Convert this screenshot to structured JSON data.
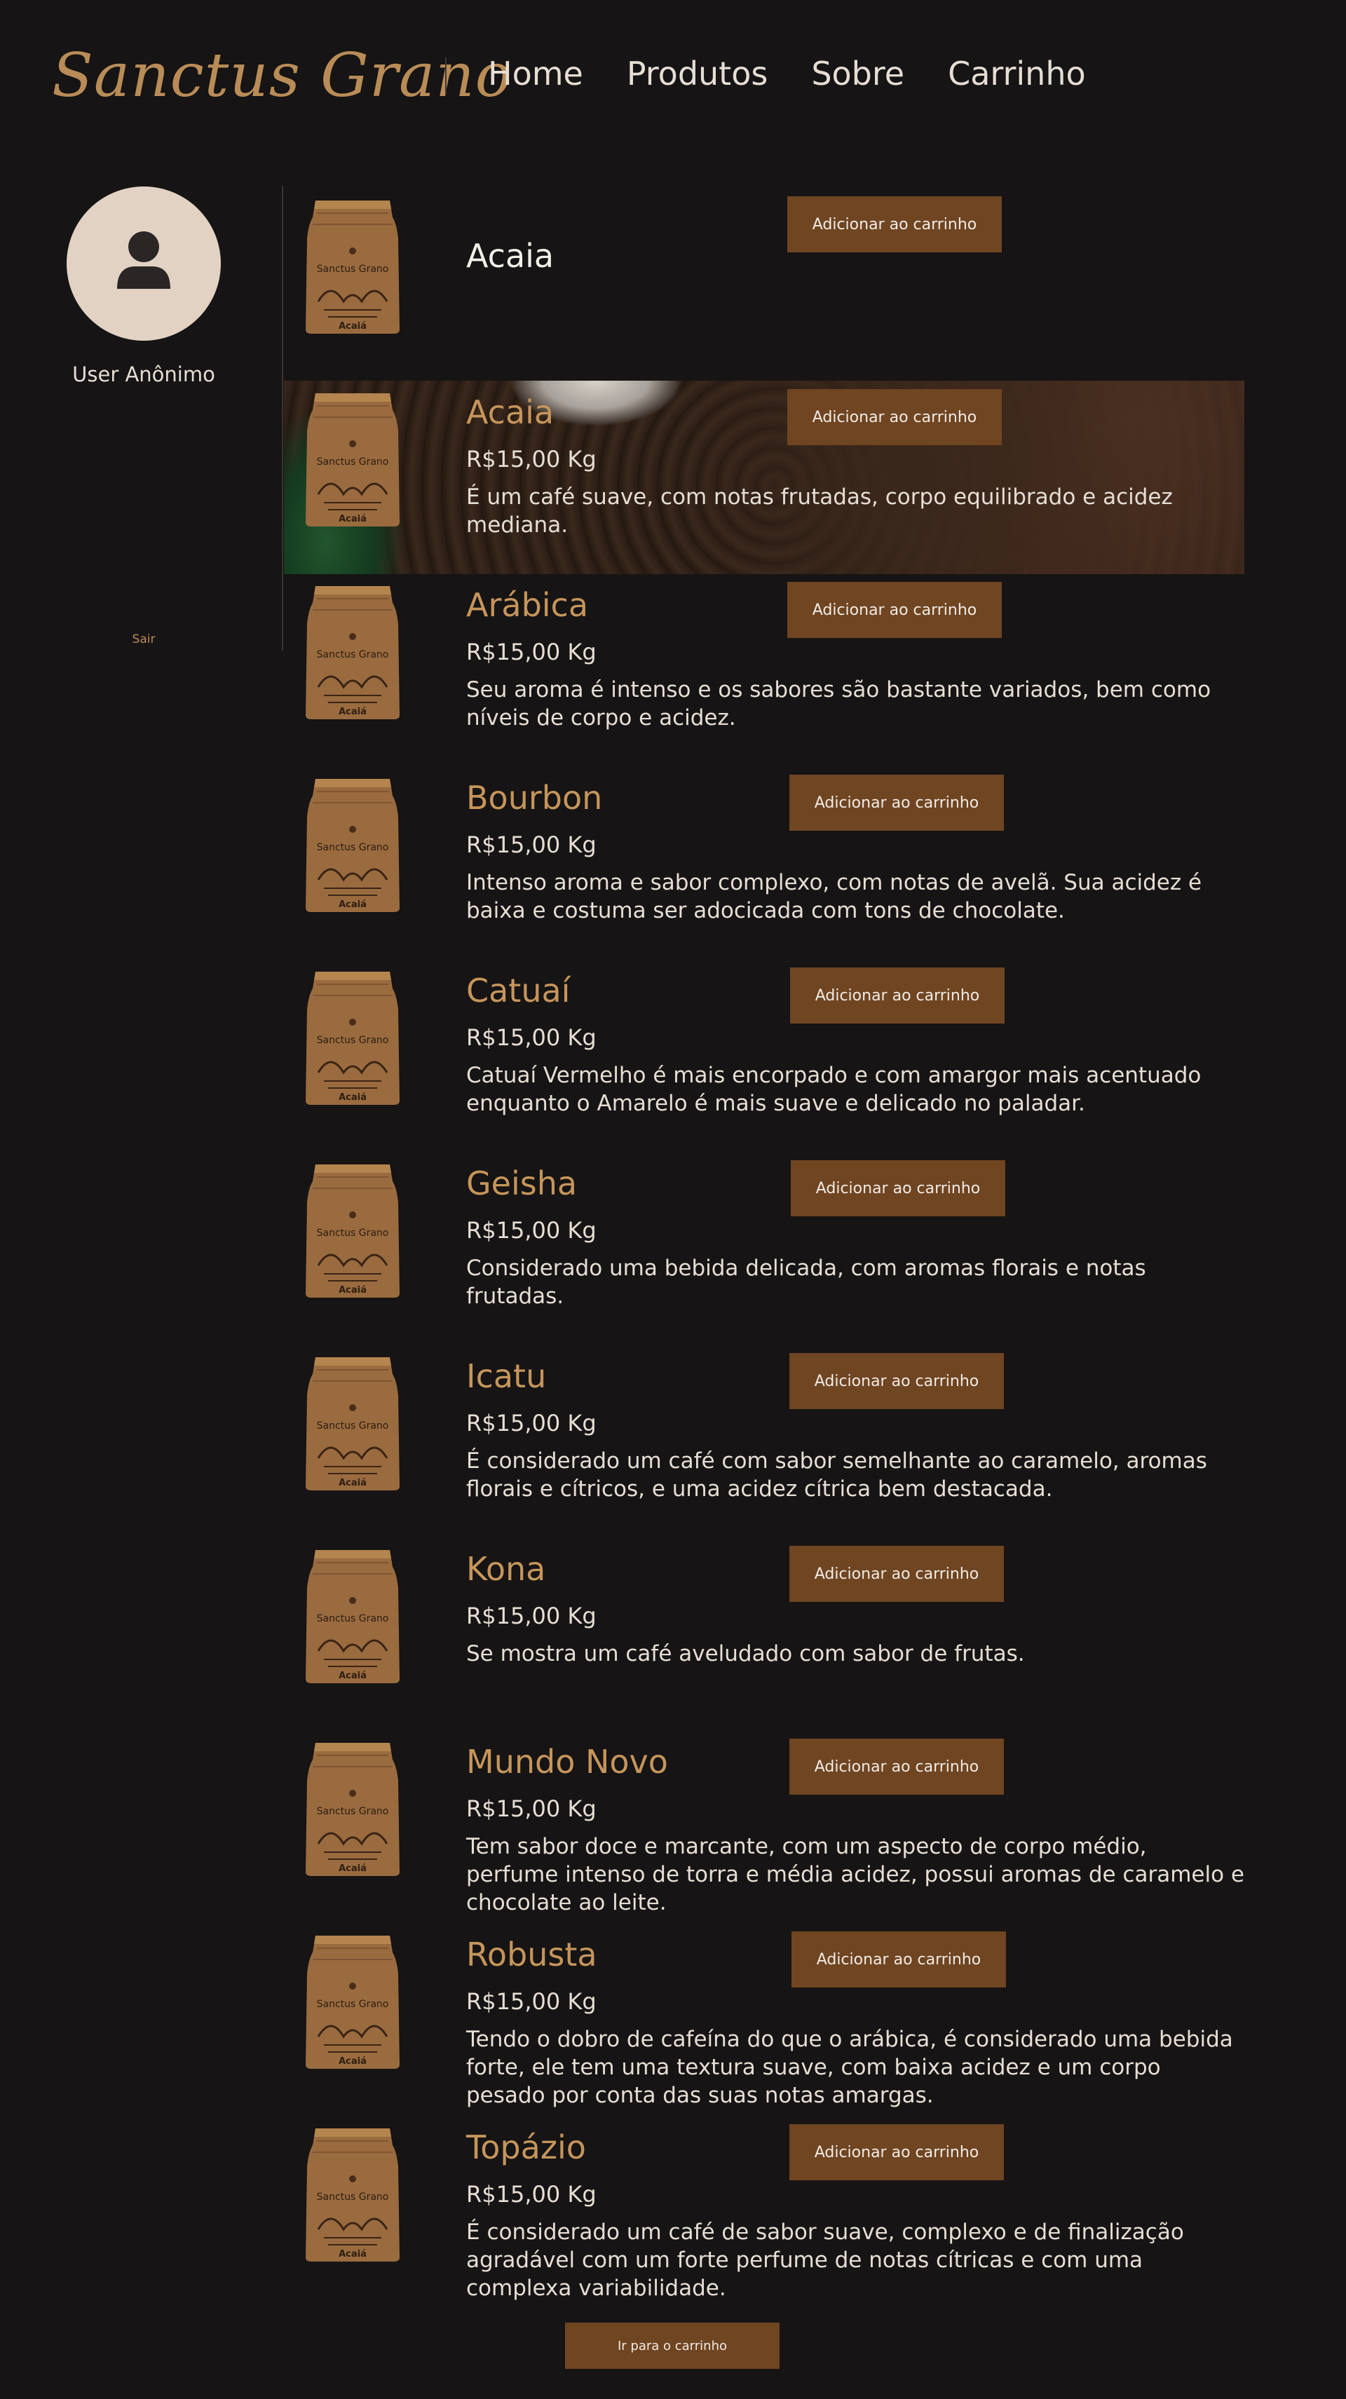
{
  "brand": {
    "logo_text": "Sanctus Grano"
  },
  "nav": {
    "items": [
      {
        "label": "Home"
      },
      {
        "label": "Produtos"
      },
      {
        "label": "Sobre"
      },
      {
        "label": "Carrinho"
      }
    ]
  },
  "sidebar": {
    "user_name": "User Anônimo",
    "logout_label": "Sair"
  },
  "bag": {
    "brand": "Sanctus Grano",
    "variety": "Acaiá"
  },
  "add_to_cart_label": "Adicionar ao carrinho",
  "featured": {
    "name": "Acaia"
  },
  "products": [
    {
      "name": "Acaia",
      "price": "R$15,00 Kg",
      "description": "É um café suave, com notas frutadas, corpo equilibrado e acidez mediana."
    },
    {
      "name": "Arábica",
      "price": "R$15,00 Kg",
      "description": "Seu aroma é intenso e os sabores são bastante variados, bem como níveis de corpo e acidez."
    },
    {
      "name": "Bourbon",
      "price": "R$15,00 Kg",
      "description": "Intenso aroma e sabor complexo, com notas de avelã. Sua acidez é baixa e costuma ser adocicada com tons de chocolate."
    },
    {
      "name": "Catuaí",
      "price": "R$15,00 Kg",
      "description": "Catuaí Vermelho é mais encorpado e com amargor mais acentuado enquanto o Amarelo é mais suave e delicado no paladar."
    },
    {
      "name": "Geisha",
      "price": "R$15,00 Kg",
      "description": "Considerado uma bebida delicada, com aromas florais e notas frutadas."
    },
    {
      "name": "Icatu",
      "price": "R$15,00 Kg",
      "description": "É considerado um café com sabor semelhante ao caramelo, aromas florais e cítricos, e uma acidez cítrica bem destacada."
    },
    {
      "name": "Kona",
      "price": "R$15,00 Kg",
      "description": "Se mostra um café aveludado com sabor de frutas."
    },
    {
      "name": "Mundo Novo",
      "price": "R$15,00 Kg",
      "description": "Tem sabor doce e marcante, com um aspecto de corpo médio, perfume intenso de torra e média acidez, possui aromas de caramelo e chocolate ao leite."
    },
    {
      "name": "Robusta",
      "price": "R$15,00 Kg",
      "description": "Tendo o dobro de cafeína do que o arábica, é considerado uma bebida forte, ele tem uma textura suave, com baixa acidez e um corpo pesado por conta das suas notas amargas."
    },
    {
      "name": "Topázio",
      "price": "R$15,00 Kg",
      "description": "É considerado um café de sabor suave, complexo e de finalização agradável com um forte perfume de notas cítricas e com uma complexa variabilidade."
    }
  ],
  "go_to_cart_label": "Ir para o carrinho",
  "colors": {
    "background": "#161414",
    "accent": "#c6955b",
    "button": "#6f4522"
  }
}
